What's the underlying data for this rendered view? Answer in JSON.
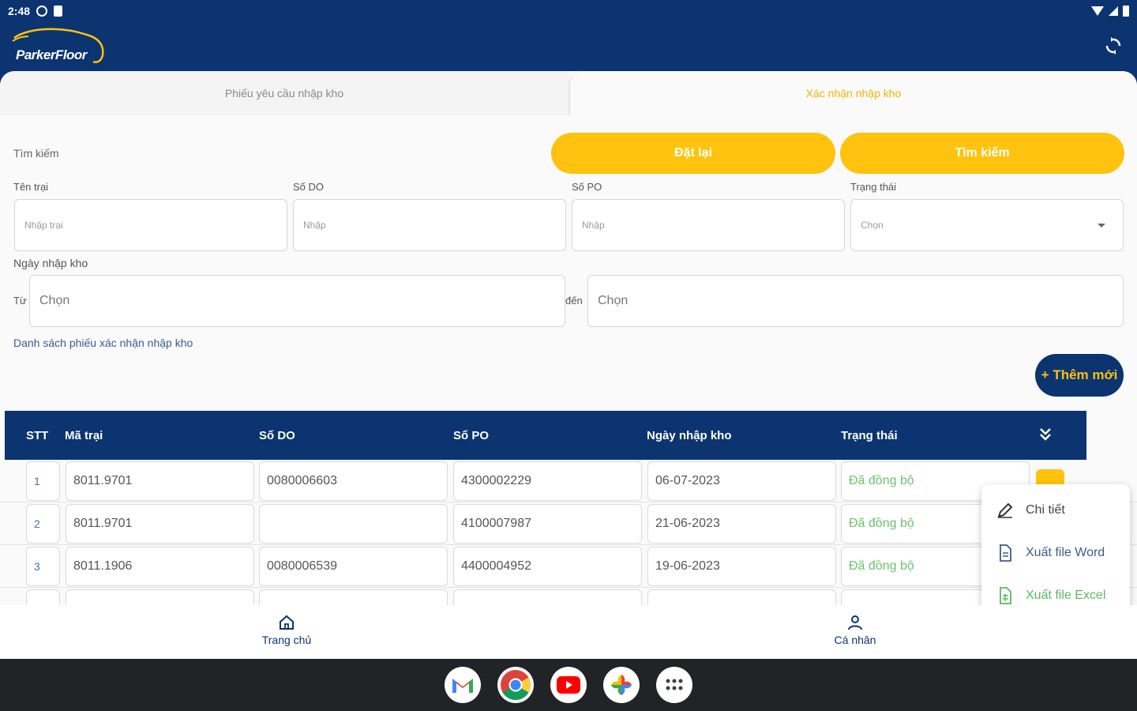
{
  "status_bar": {
    "time": "2:48"
  },
  "app": {
    "logo_text": "ParkerFloor"
  },
  "tabs": [
    {
      "label": "Phiếu yêu cầu nhập kho",
      "active": false
    },
    {
      "label": "Xác nhận nhập kho",
      "active": true
    }
  ],
  "search": {
    "title": "Tìm kiếm",
    "reset_label": "Đặt lại",
    "search_label": "Tìm kiếm",
    "fields": [
      {
        "label": "Tên trại",
        "placeholder": "Nhập trại"
      },
      {
        "label": "Số DO",
        "placeholder": "Nhập"
      },
      {
        "label": "Số PO",
        "placeholder": "Nhập"
      },
      {
        "label": "Trạng thái",
        "placeholder": "Chọn"
      }
    ],
    "date_label": "Ngày nhập kho",
    "from_label": "Từ",
    "to_label": "đến",
    "from_placeholder": "Chọn",
    "to_placeholder": "Chọn"
  },
  "list": {
    "title": "Danh sách phiếu xác nhận nhập kho",
    "add_label": "+ Thêm mới",
    "columns": [
      "STT",
      "Mã trại",
      "Số DO",
      "Số PO",
      "Ngày nhập kho",
      "Trạng thái"
    ],
    "rows": [
      {
        "stt": "1",
        "ma_trai": "8011.9701",
        "so_do": "0080006603",
        "so_po": "4300002229",
        "ngay": "06-07-2023",
        "trang_thai": "Đã đồng bộ"
      },
      {
        "stt": "2",
        "ma_trai": "8011.9701",
        "so_do": "",
        "so_po": "4100007987",
        "ngay": "21-06-2023",
        "trang_thai": "Đã đồng bộ"
      },
      {
        "stt": "3",
        "ma_trai": "8011.1906",
        "so_do": "0080006539",
        "so_po": "4400004952",
        "ngay": "19-06-2023",
        "trang_thai": "Đã đồng bộ"
      }
    ]
  },
  "popup_menu": {
    "items": [
      {
        "label": "Chi tiết",
        "icon": "edit-icon"
      },
      {
        "label": "Xuất file Word",
        "icon": "word-file-icon"
      },
      {
        "label": "Xuất file Excel",
        "icon": "excel-file-icon"
      }
    ]
  },
  "bottom_nav": [
    {
      "label": "Trang chủ",
      "icon": "home-icon"
    },
    {
      "label": "Cá nhân",
      "icon": "user-icon"
    }
  ],
  "dock": [
    "gmail-icon",
    "chrome-icon",
    "youtube-icon",
    "photos-icon",
    "apps-grid-icon"
  ],
  "colors": {
    "primary": "#0b3470",
    "accent": "#ffc20e",
    "success": "#6bc36b"
  }
}
